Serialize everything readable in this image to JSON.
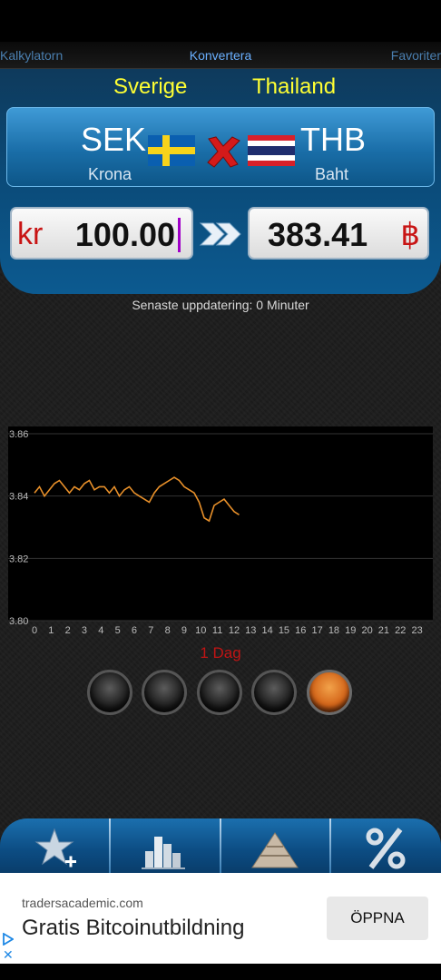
{
  "tabs": {
    "left": "Kalkylatorn",
    "center": "Konvertera",
    "right": "Favoriter"
  },
  "countries": {
    "from": "Sverige",
    "to": "Thailand"
  },
  "pair": {
    "from_code": "SEK",
    "from_name": "Krona",
    "to_code": "THB",
    "to_name": "Baht"
  },
  "amounts": {
    "from_symbol": "kr",
    "from_value": "100.00",
    "to_value": "383.41",
    "to_symbol": "฿"
  },
  "update_text": "Senaste uppdatering: 0 Minuter",
  "period_label": "1 Dag",
  "range_buttons": [
    {
      "active": false
    },
    {
      "active": false
    },
    {
      "active": false
    },
    {
      "active": false
    },
    {
      "active": true
    }
  ],
  "toolbar": [
    "star-add-icon",
    "bar-chart-icon",
    "pyramid-icon",
    "percent-icon"
  ],
  "ad": {
    "domain": "tradersacademic.com",
    "title": "Gratis Bitcoinutbildning",
    "button": "ÖPPNA"
  },
  "colors": {
    "accent_yellow": "#ffff33",
    "panel_blue": "#0b4b79",
    "currency_red": "#c81414",
    "line_orange": "#e8902a"
  },
  "chart_data": {
    "type": "line",
    "x_ticks": [
      "0",
      "1",
      "2",
      "3",
      "4",
      "5",
      "6",
      "7",
      "8",
      "9",
      "10",
      "11",
      "12",
      "13",
      "14",
      "15",
      "16",
      "17",
      "18",
      "19",
      "20",
      "21",
      "22",
      "23"
    ],
    "y_ticks": [
      "3.80",
      "3.82",
      "3.84",
      "3.86"
    ],
    "ylim": [
      3.8,
      3.86
    ],
    "xlim": [
      0,
      23.8
    ],
    "grid": true,
    "series": [
      {
        "color": "#e8902a",
        "x": [
          0,
          0.3,
          0.6,
          0.9,
          1.2,
          1.5,
          1.8,
          2.1,
          2.4,
          2.7,
          3.0,
          3.3,
          3.6,
          3.9,
          4.2,
          4.5,
          4.8,
          5.1,
          5.4,
          5.7,
          6.0,
          6.3,
          6.6,
          6.9,
          7.2,
          7.5,
          7.8,
          8.1,
          8.4,
          8.7,
          9.0,
          9.3,
          9.6,
          9.9,
          10.2,
          10.5,
          10.8,
          11.1,
          11.4,
          11.7,
          12.0,
          12.3
        ],
        "y": [
          3.841,
          3.843,
          3.84,
          3.842,
          3.844,
          3.845,
          3.843,
          3.841,
          3.843,
          3.842,
          3.844,
          3.845,
          3.842,
          3.843,
          3.843,
          3.841,
          3.843,
          3.84,
          3.842,
          3.843,
          3.841,
          3.84,
          3.839,
          3.838,
          3.841,
          3.843,
          3.844,
          3.845,
          3.846,
          3.845,
          3.843,
          3.842,
          3.841,
          3.838,
          3.833,
          3.832,
          3.837,
          3.838,
          3.839,
          3.837,
          3.835,
          3.834
        ]
      }
    ]
  }
}
